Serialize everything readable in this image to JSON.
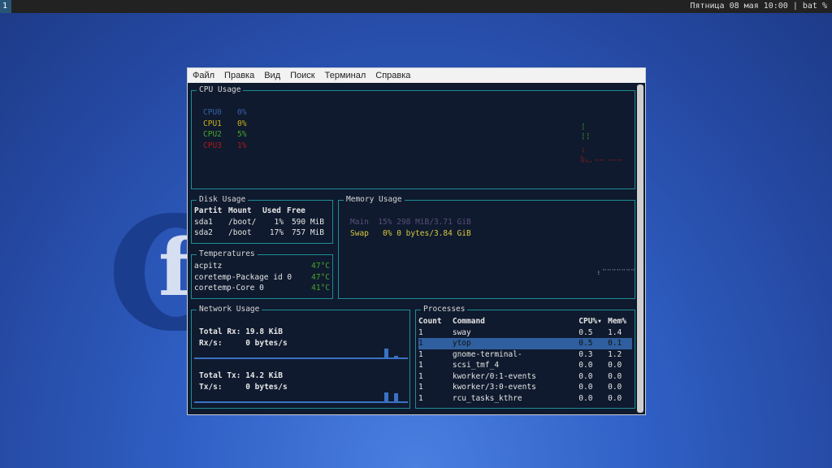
{
  "topbar": {
    "workspace": "1",
    "status": "Пятница 08 мая 10:00 | bat %"
  },
  "menu": [
    "Файл",
    "Правка",
    "Вид",
    "Поиск",
    "Терминал",
    "Справка"
  ],
  "cpu": {
    "title": "CPU Usage",
    "items": [
      {
        "name": "CPU0",
        "value": "0%",
        "color": "#3a5fa8"
      },
      {
        "name": "CPU1",
        "value": "0%",
        "color": "#c9b01a"
      },
      {
        "name": "CPU2",
        "value": "5%",
        "color": "#4aa52a"
      },
      {
        "name": "CPU3",
        "value": "1%",
        "color": "#b01818"
      }
    ]
  },
  "disk": {
    "title": "Disk Usage",
    "headers": [
      "Partit",
      "Mount",
      "Used",
      "Free"
    ],
    "rows": [
      [
        "sda1",
        "/boot/",
        "1%",
        "590 MiB"
      ],
      [
        "sda2",
        "/boot",
        "17%",
        "757 MiB"
      ]
    ]
  },
  "temps": {
    "title": "Temperatures",
    "rows": [
      [
        "acpitz",
        "47°C"
      ],
      [
        "coretemp-Package id 0",
        "47°C"
      ],
      [
        "coretemp-Core 0",
        "41°C"
      ]
    ]
  },
  "memory": {
    "title": "Memory Usage",
    "main": "Main  15% 298 MiB/3.71 GiB",
    "swap": "Swap   0% 0 bytes/3.84 GiB"
  },
  "network": {
    "title": "Network Usage",
    "rx_total": "Total Rx: 19.8 KiB",
    "rx_rate": "Rx/s:     0 bytes/s",
    "tx_total": "Total Tx: 14.2 KiB",
    "tx_rate": "Tx/s:     0 bytes/s"
  },
  "processes": {
    "title": "Processes",
    "headers": [
      "Count",
      "Command",
      "CPU%▾",
      "Mem%"
    ],
    "rows": [
      [
        "1",
        "sway",
        "0.5",
        "1.4"
      ],
      [
        "1",
        "ytop",
        "0.5",
        "0.1"
      ],
      [
        "1",
        "gnome-terminal-",
        "0.3",
        "1.2"
      ],
      [
        "1",
        "scsi_tmf_4",
        "0.0",
        "0.0"
      ],
      [
        "1",
        "kworker/0:1-events",
        "0.0",
        "0.0"
      ],
      [
        "1",
        "kworker/3:0-events",
        "0.0",
        "0.0"
      ],
      [
        "1",
        "rcu_tasks_kthre",
        "0.0",
        "0.0"
      ]
    ],
    "selected": 1
  }
}
